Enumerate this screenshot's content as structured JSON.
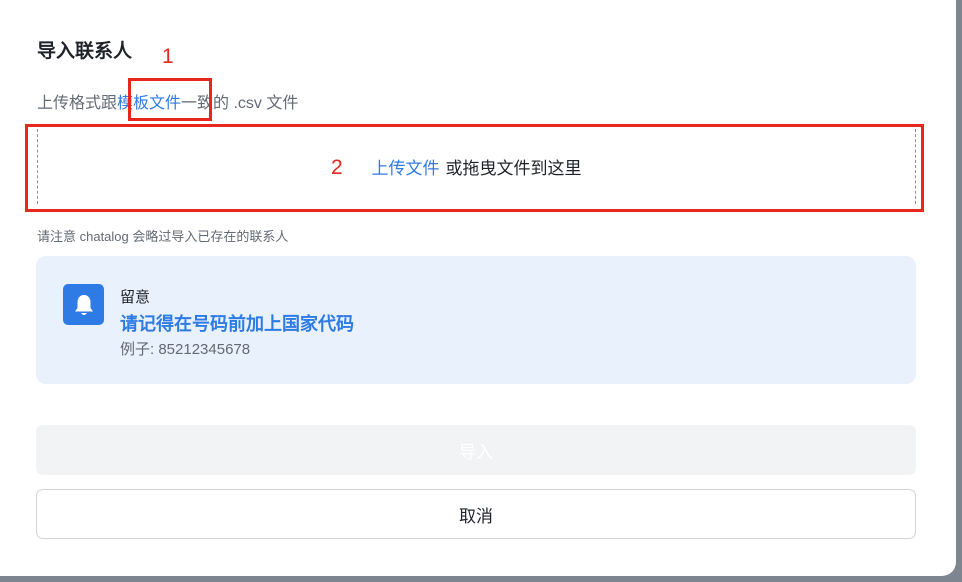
{
  "dialog": {
    "title": "导入联系人",
    "subtitle_prefix": "上传格式跟",
    "subtitle_link": "模板文件",
    "subtitle_suffix": "一致的 .csv 文件",
    "dropzone": {
      "upload_link": "上传文件",
      "drag_text": "或拖曳文件到这里"
    },
    "note": "请注意 chatalog 会略过导入已存在的联系人",
    "notice": {
      "icon": "bell-icon",
      "label": "留意",
      "main": "请记得在号码前加上国家代码",
      "example": "例子: 85212345678"
    },
    "buttons": {
      "import": "导入",
      "cancel": "取消"
    }
  },
  "annotations": {
    "marker_1": "1",
    "marker_2": "2"
  },
  "colors": {
    "accent": "#2f7be5",
    "annotation": "#e8271c",
    "notice_bg": "#e8f1fc"
  }
}
